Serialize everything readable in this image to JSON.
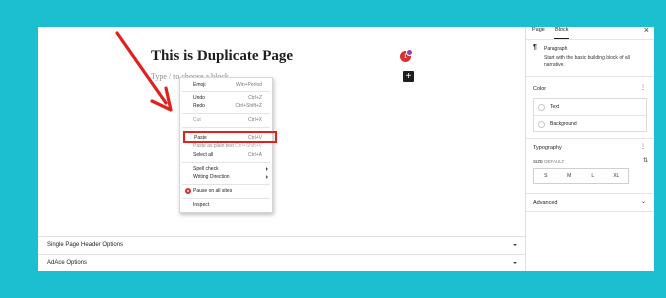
{
  "editor": {
    "page_title": "This is Duplicate Page",
    "placeholder": "Type / to choose a block",
    "badge_count": "1",
    "add_block_symbol": "+"
  },
  "context_menu": {
    "items": [
      {
        "label": "Emoji",
        "shortcut": "Win+Period"
      },
      {
        "label": "Undo",
        "shortcut": "Ctrl+Z"
      },
      {
        "label": "Redo",
        "shortcut": "Ctrl+Shift+Z"
      },
      {
        "label": "Cut",
        "shortcut": "Ctrl+X"
      },
      {
        "label": "Paste",
        "shortcut": "Ctrl+V"
      },
      {
        "label": "Paste as plain text",
        "shortcut": "Ctrl+Shift+V"
      },
      {
        "label": "Select all",
        "shortcut": "Ctrl+A"
      },
      {
        "label": "Spell check"
      },
      {
        "label": "Writing Direction"
      },
      {
        "label": "Pause on all sites"
      },
      {
        "label": "Inspect"
      }
    ]
  },
  "meta_boxes": [
    {
      "label": "Single Page Header Options"
    },
    {
      "label": "AdAce Options"
    }
  ],
  "sidebar": {
    "tabs": [
      "Page",
      "Block"
    ],
    "close_symbol": "×",
    "block": {
      "icon_symbol": "¶",
      "name": "Paragraph",
      "description": "Start with the basic building block of all narrative."
    },
    "color_panel": {
      "title": "Color",
      "options": [
        "Text",
        "Background"
      ]
    },
    "typography_panel": {
      "title": "Typography",
      "size_label": "SIZE",
      "size_value": "DEFAULT",
      "sizes": [
        "S",
        "M",
        "L",
        "XL"
      ]
    },
    "advanced_panel": {
      "title": "Advanced"
    }
  },
  "colors": {
    "background": "#1bbfcf",
    "highlight": "#e0221f",
    "badge": "#d6322d"
  },
  "icons": [
    "arrow-annotation",
    "add-block-icon",
    "paragraph-icon",
    "close-icon",
    "more-options-icon",
    "chevron-down-icon",
    "sliders-icon"
  ]
}
